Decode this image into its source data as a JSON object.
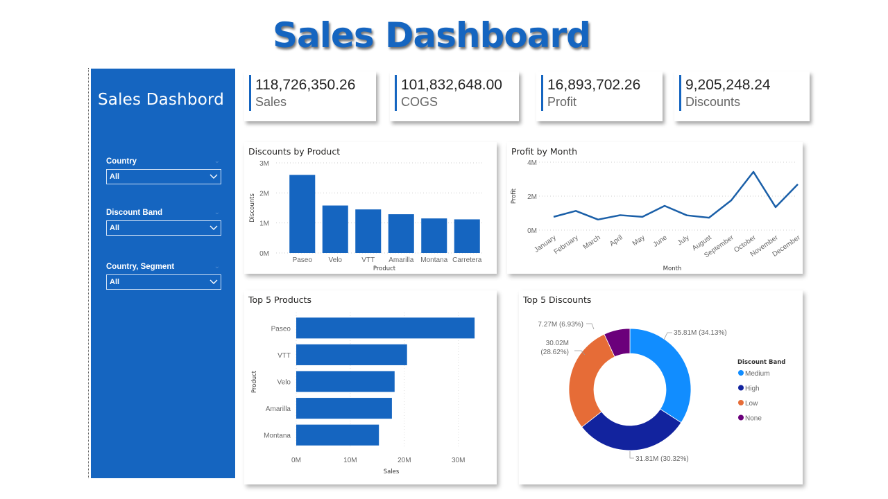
{
  "header": {
    "title": "Sales Dashboard"
  },
  "sidebar": {
    "title": "Sales Dashbord",
    "slicers": [
      {
        "label": "Country",
        "value": "All"
      },
      {
        "label": "Discount Band",
        "value": "All"
      },
      {
        "label": "Country, Segment",
        "value": "All"
      }
    ]
  },
  "cards": [
    {
      "value": "118,726,350.26",
      "label": "Sales"
    },
    {
      "value": "101,832,648.00",
      "label": "COGS"
    },
    {
      "value": "16,893,702.26",
      "label": "Profit"
    },
    {
      "value": "9,205,248.24",
      "label": "Discounts"
    }
  ],
  "colors": {
    "primary": "#1565c0",
    "bar": "#1565c0",
    "line": "#1a5fa8"
  },
  "chart_data": [
    {
      "id": "discounts_by_product",
      "type": "bar",
      "title": "Discounts by Product",
      "xlabel": "Product",
      "ylabel": "Discounts",
      "categories": [
        "Paseo",
        "Velo",
        "VTT",
        "Amarilla",
        "Montana",
        "Carretera"
      ],
      "values": [
        2.6,
        1.58,
        1.45,
        1.29,
        1.15,
        1.12
      ],
      "unit": "M",
      "ylim": [
        0,
        3
      ],
      "yticks": [
        "0M",
        "1M",
        "2M",
        "3M"
      ],
      "grid": true
    },
    {
      "id": "profit_by_month",
      "type": "line",
      "title": "Profit by Month",
      "xlabel": "Month",
      "ylabel": "Profit",
      "categories": [
        "January",
        "February",
        "March",
        "April",
        "May",
        "June",
        "July",
        "August",
        "September",
        "October",
        "November",
        "December"
      ],
      "values": [
        0.78,
        1.13,
        0.62,
        0.88,
        0.78,
        1.43,
        0.87,
        0.73,
        1.75,
        3.43,
        1.35,
        2.7
      ],
      "unit": "M",
      "ylim": [
        0,
        4
      ],
      "yticks": [
        "0M",
        "2M",
        "4M"
      ],
      "grid": true
    },
    {
      "id": "top5_products",
      "type": "bar",
      "orientation": "horizontal",
      "title": "Top 5 Products",
      "xlabel": "Sales",
      "ylabel": "Product",
      "categories": [
        "Paseo",
        "VTT",
        "Velo",
        "Amarilla",
        "Montana"
      ],
      "values": [
        33.0,
        20.5,
        18.2,
        17.7,
        15.3
      ],
      "unit": "M",
      "xlim": [
        0,
        33.5
      ],
      "xticks": [
        "0M",
        "10M",
        "20M",
        "30M"
      ],
      "grid": true
    },
    {
      "id": "top5_discounts",
      "type": "pie",
      "donut": true,
      "title": "Top 5 Discounts",
      "legend_title": "Discount Band",
      "legend_position": "right",
      "slices": [
        {
          "name": "Medium",
          "value": 35.81,
          "label": "35.81M (34.13%)",
          "color": "#118dff"
        },
        {
          "name": "High",
          "value": 31.81,
          "label": "31.81M (30.32%)",
          "color": "#12239e"
        },
        {
          "name": "Low",
          "value": 30.02,
          "label": "30.02M (28.62%)",
          "label_lines": [
            "30.02M",
            "(28.62%)"
          ],
          "color": "#e66c37"
        },
        {
          "name": "None",
          "value": 7.27,
          "label": "7.27M (6.93%)",
          "color": "#6b007b"
        }
      ]
    }
  ]
}
